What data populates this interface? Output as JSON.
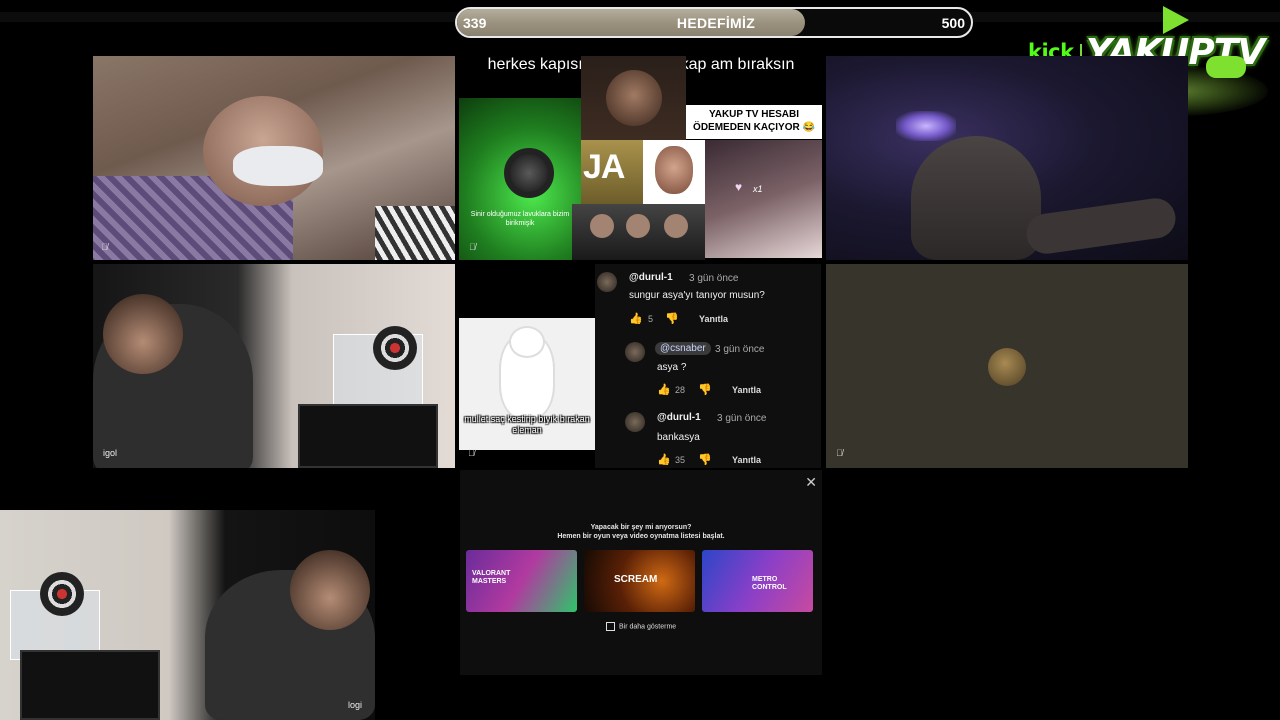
{
  "goal": {
    "current": "339",
    "title": "HEDEFİMİZ",
    "target": "500",
    "progress": 0.678
  },
  "logo": {
    "kick": "kick",
    "name": "YAKUPTV"
  },
  "cams": {
    "ml_label": "igol",
    "bl_label": "logi"
  },
  "memes": {
    "caption": "herkes kapısının önüne bir kap am bıraksın",
    "green_text": "Sinir olduğumuz lavuklara bizim birikmişik",
    "banner": "YAKUP TV HESABI ÖDEMEDEN KAÇIYOR 😂",
    "ja": "JA",
    "x1": "x1",
    "michelin_text": "mullet saç kestirip bıyık bırakan eleman"
  },
  "comments": [
    {
      "user": "@durul-1",
      "time": "3 gün önce",
      "text": "sungur asya'yı tanıyor musun?",
      "likes": "5",
      "reply": "Yanıtla"
    },
    {
      "user": "@csnaber",
      "time": "3 gün önce",
      "text": "asya ?",
      "likes": "28",
      "reply": "Yanıtla"
    },
    {
      "user": "@durul-1",
      "time": "3 gün önce",
      "text": "bankasya",
      "likes": "35",
      "reply": "Yanıtla"
    }
  ],
  "popup": {
    "title": "Yapacak bir şey mi arıyorsun?",
    "subtitle": "Hemen bir oyun veya video oynatma listesi başlat.",
    "cards": [
      {
        "title": "VALORANT MASTERS"
      },
      {
        "title": "SCREAM"
      },
      {
        "title": "METRO CONTROL"
      }
    ],
    "checkbox_label": "Bir daha gösterme"
  },
  "icons": {
    "close": "close-icon",
    "mic_muted": "mic-muted-icon",
    "thumbs_up": "thumbs-up-icon",
    "thumbs_down": "thumbs-down-icon"
  },
  "colors": {
    "kick_green": "#53fc18",
    "goal_fill": "#a59d89",
    "background": "#000000"
  }
}
